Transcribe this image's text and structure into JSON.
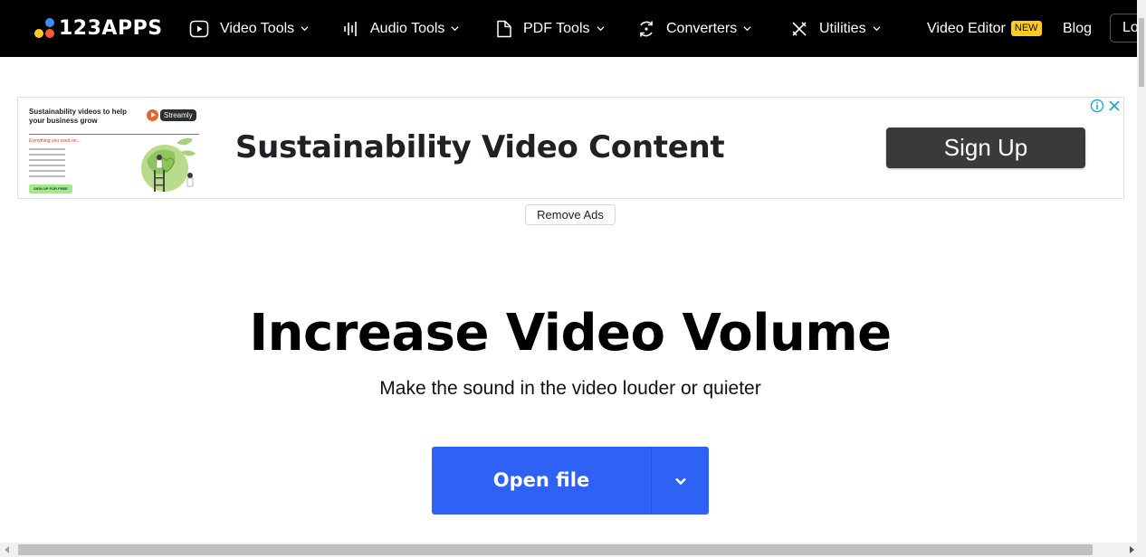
{
  "header": {
    "logo_text": "123APPS",
    "logo_colors": {
      "blue": "#3d8bff",
      "yellow": "#ffc933",
      "red": "#ff5a36"
    },
    "nav": [
      {
        "label": "Video Tools",
        "icon": "play-square-icon",
        "has_dropdown": true
      },
      {
        "label": "Audio Tools",
        "icon": "audio-wave-icon",
        "has_dropdown": true
      },
      {
        "label": "PDF Tools",
        "icon": "file-icon",
        "has_dropdown": true
      },
      {
        "label": "Converters",
        "icon": "convert-cycle-icon",
        "has_dropdown": true
      },
      {
        "label": "Utilities",
        "icon": "tools-icon",
        "has_dropdown": true
      }
    ],
    "video_editor_label": "Video Editor",
    "new_badge": "NEW",
    "blog_label": "Blog",
    "login_label": "Log"
  },
  "ad": {
    "creative": {
      "title": "Sustainability videos to help your business grow",
      "brand": "Streamly",
      "subtitle": "Everything you need on...",
      "cta": "SIGN UP FOR FREE"
    },
    "headline": "Sustainability Video Content",
    "cta_label": "Sign Up",
    "info_icon": "info-icon",
    "close_icon": "close-icon",
    "accent_color": "#1fa8c9"
  },
  "remove_ads_label": "Remove Ads",
  "main": {
    "title": "Increase Video Volume",
    "subtitle": "Make the sound in the video louder or quieter",
    "open_file_label": "Open file",
    "button_color": "#2e61f6"
  }
}
